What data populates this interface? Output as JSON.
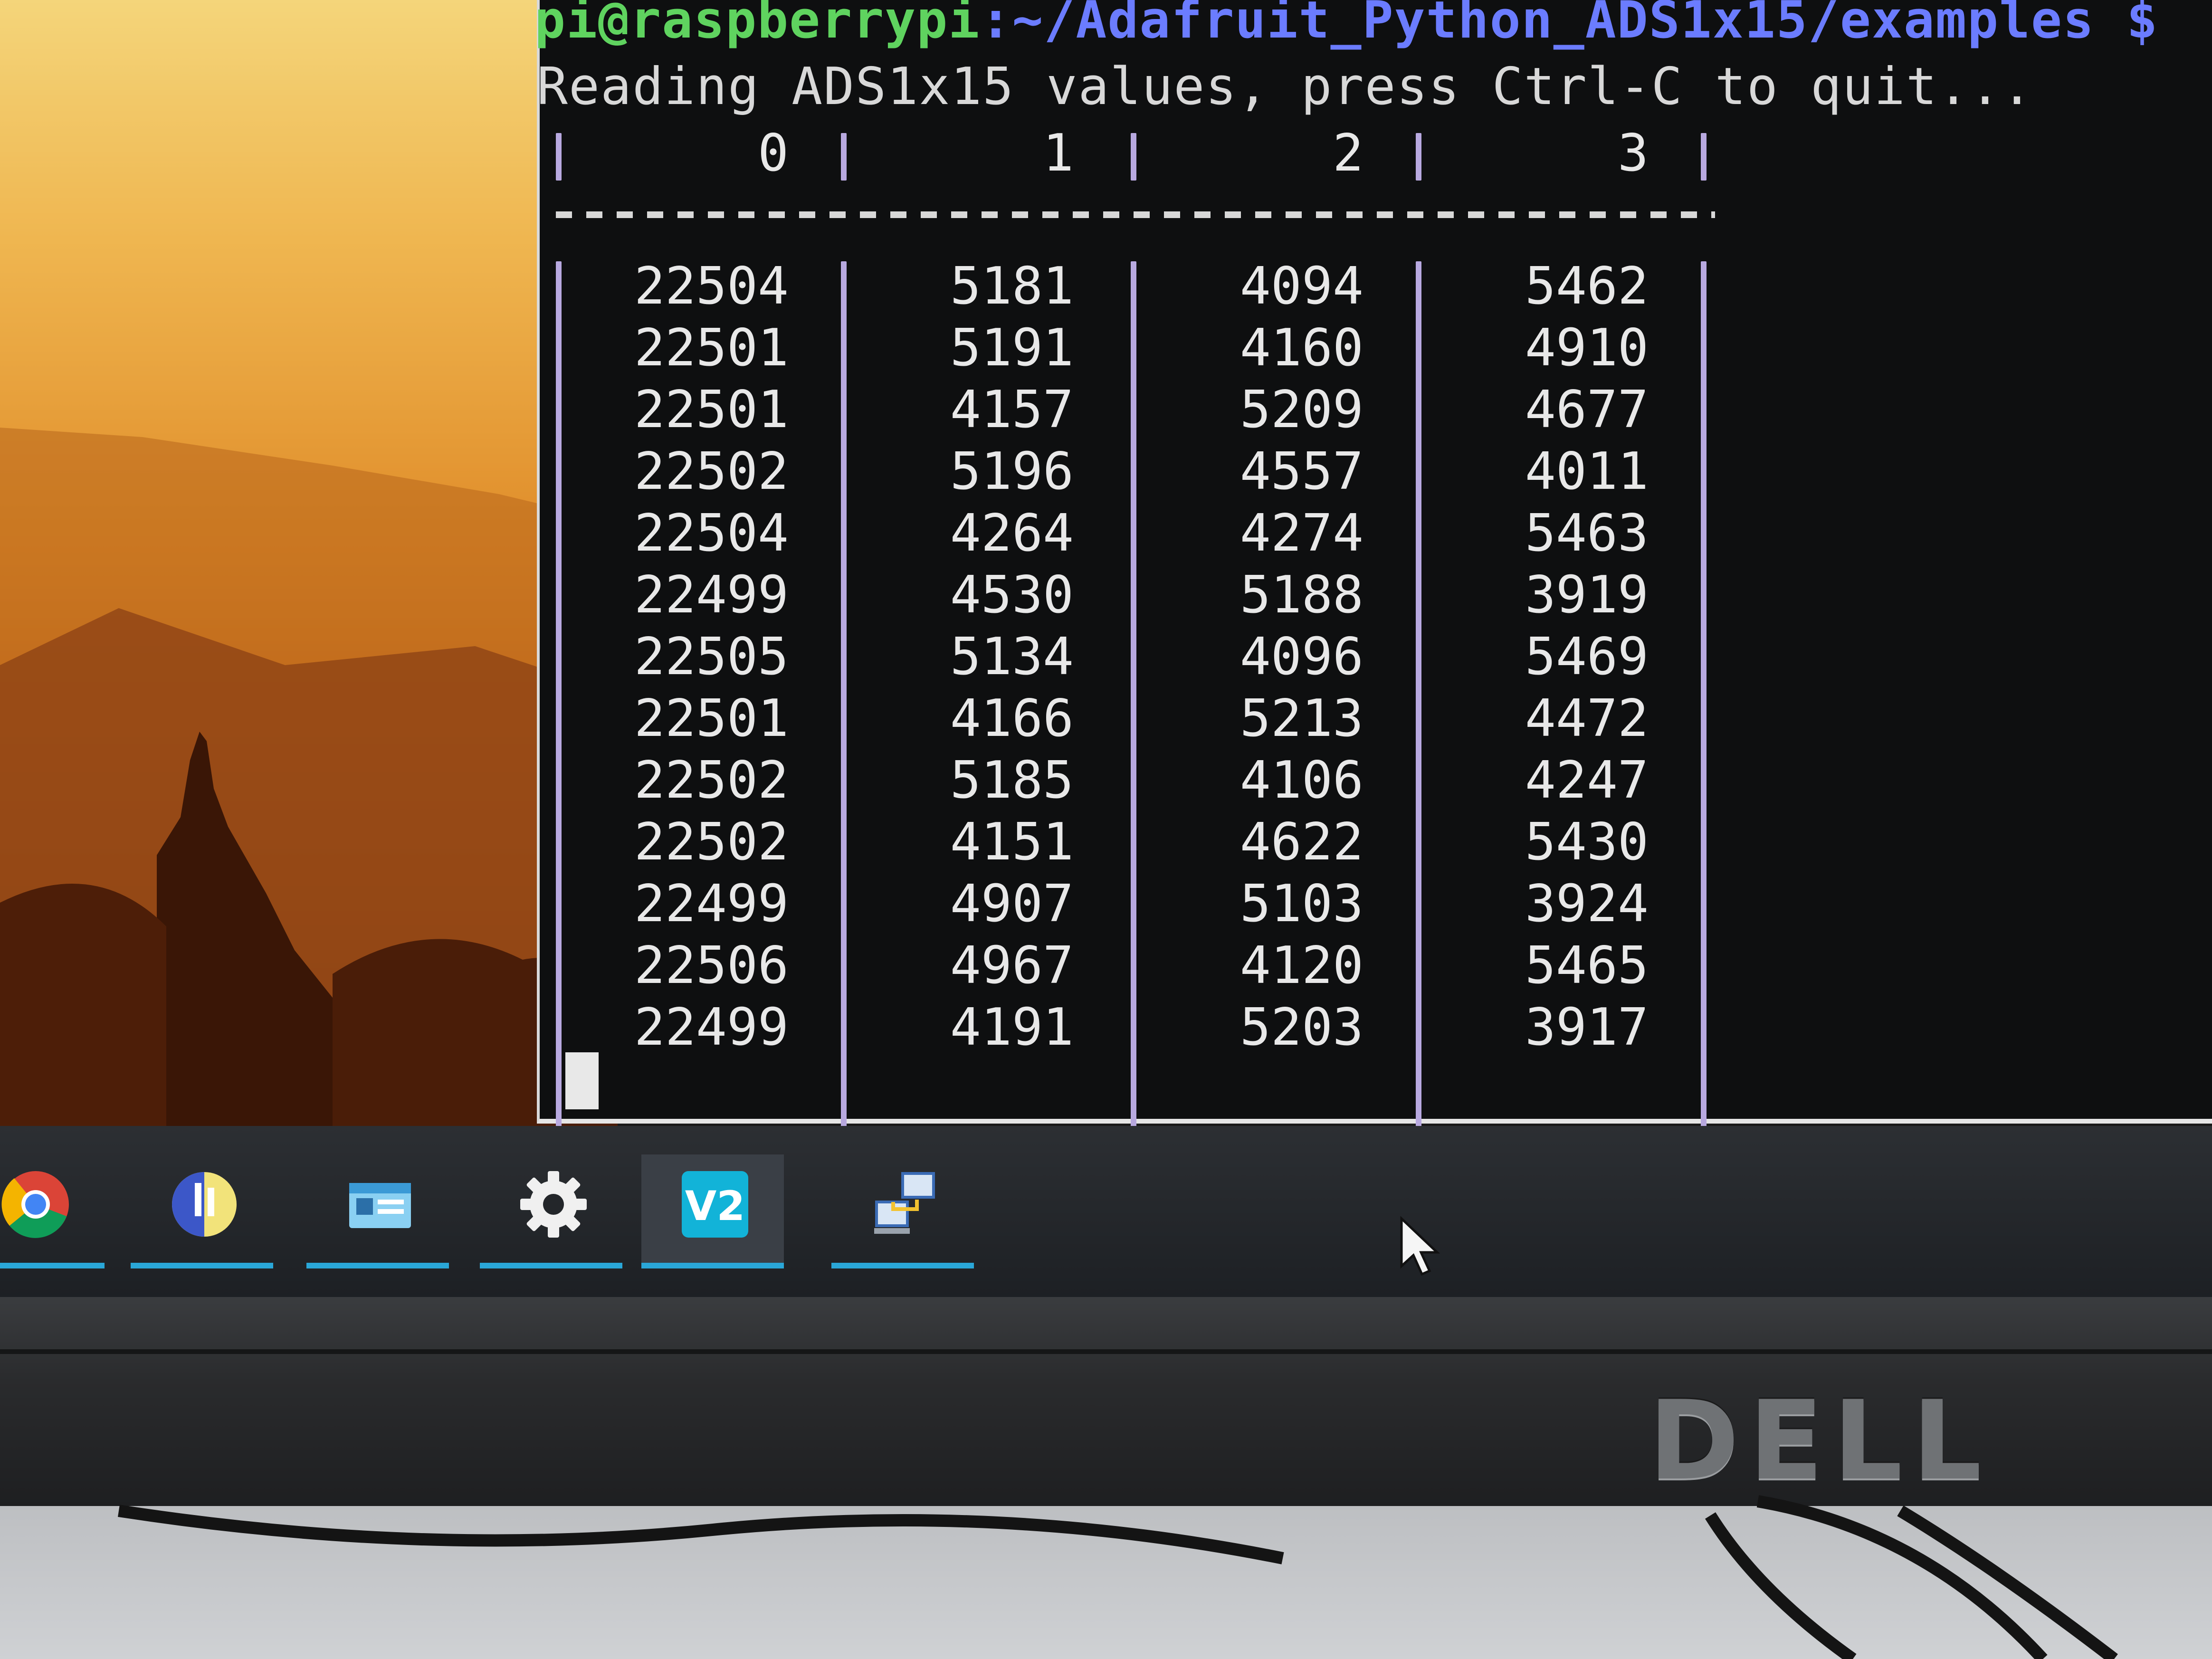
{
  "terminal": {
    "prompt_user": "pi@raspberrypi",
    "prompt_path": ":~/Adafruit_Python_ADS1x15/examples",
    "prompt_symbol": "$",
    "info_line": "Reading ADS1x15 values, press Ctrl-C to quit...",
    "headers": [
      "0",
      "1",
      "2",
      "3"
    ],
    "rows": [
      [
        "22504",
        "5181",
        "4094",
        "5462"
      ],
      [
        "22501",
        "5191",
        "4160",
        "4910"
      ],
      [
        "22501",
        "4157",
        "5209",
        "4677"
      ],
      [
        "22502",
        "5196",
        "4557",
        "4011"
      ],
      [
        "22504",
        "4264",
        "4274",
        "5463"
      ],
      [
        "22499",
        "4530",
        "5188",
        "3919"
      ],
      [
        "22505",
        "5134",
        "4096",
        "5469"
      ],
      [
        "22501",
        "4166",
        "5213",
        "4472"
      ],
      [
        "22502",
        "5185",
        "4106",
        "4247"
      ],
      [
        "22502",
        "4151",
        "4622",
        "5430"
      ],
      [
        "22499",
        "4907",
        "5103",
        "3924"
      ],
      [
        "22506",
        "4967",
        "4120",
        "5465"
      ],
      [
        "22499",
        "4191",
        "5203",
        "3917"
      ]
    ]
  },
  "taskbar": {
    "items": [
      {
        "name": "chrome-icon"
      },
      {
        "name": "thonny-icon"
      },
      {
        "name": "file-manager-icon"
      },
      {
        "name": "gear-icon"
      },
      {
        "name": "vnc-icon",
        "label": "V2"
      },
      {
        "name": "network-icon"
      }
    ]
  },
  "monitor": {
    "brand": "DELL"
  },
  "colors": {
    "prompt_user": "#5fd35f",
    "prompt_path": "#6b7cff",
    "taskbar_accent": "#2aa7d8",
    "terminal_bg": "#0e0f10"
  }
}
